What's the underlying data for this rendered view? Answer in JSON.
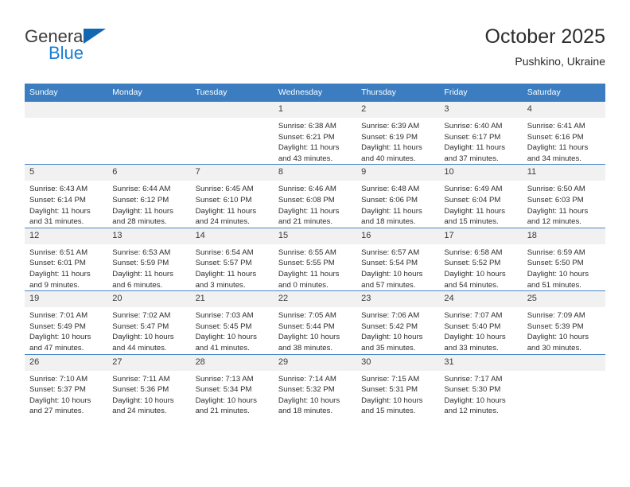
{
  "brand": {
    "line1": "General",
    "line2": "Blue",
    "logo_icon": "triangle-flag-icon"
  },
  "header": {
    "title": "October 2025",
    "subtitle": "Pushkino, Ukraine"
  },
  "calendar": {
    "weekday_headers": [
      "Sunday",
      "Monday",
      "Tuesday",
      "Wednesday",
      "Thursday",
      "Friday",
      "Saturday"
    ],
    "accent_color": "#3b7dc0",
    "daynum_bg": "#f1f1f1",
    "weeks": [
      [
        {
          "day": "",
          "info": "",
          "empty": true
        },
        {
          "day": "",
          "info": "",
          "empty": true
        },
        {
          "day": "",
          "info": "",
          "empty": true
        },
        {
          "day": "1",
          "info": "Sunrise: 6:38 AM\nSunset: 6:21 PM\nDaylight: 11 hours\nand 43 minutes."
        },
        {
          "day": "2",
          "info": "Sunrise: 6:39 AM\nSunset: 6:19 PM\nDaylight: 11 hours\nand 40 minutes."
        },
        {
          "day": "3",
          "info": "Sunrise: 6:40 AM\nSunset: 6:17 PM\nDaylight: 11 hours\nand 37 minutes."
        },
        {
          "day": "4",
          "info": "Sunrise: 6:41 AM\nSunset: 6:16 PM\nDaylight: 11 hours\nand 34 minutes."
        }
      ],
      [
        {
          "day": "5",
          "info": "Sunrise: 6:43 AM\nSunset: 6:14 PM\nDaylight: 11 hours\nand 31 minutes."
        },
        {
          "day": "6",
          "info": "Sunrise: 6:44 AM\nSunset: 6:12 PM\nDaylight: 11 hours\nand 28 minutes."
        },
        {
          "day": "7",
          "info": "Sunrise: 6:45 AM\nSunset: 6:10 PM\nDaylight: 11 hours\nand 24 minutes."
        },
        {
          "day": "8",
          "info": "Sunrise: 6:46 AM\nSunset: 6:08 PM\nDaylight: 11 hours\nand 21 minutes."
        },
        {
          "day": "9",
          "info": "Sunrise: 6:48 AM\nSunset: 6:06 PM\nDaylight: 11 hours\nand 18 minutes."
        },
        {
          "day": "10",
          "info": "Sunrise: 6:49 AM\nSunset: 6:04 PM\nDaylight: 11 hours\nand 15 minutes."
        },
        {
          "day": "11",
          "info": "Sunrise: 6:50 AM\nSunset: 6:03 PM\nDaylight: 11 hours\nand 12 minutes."
        }
      ],
      [
        {
          "day": "12",
          "info": "Sunrise: 6:51 AM\nSunset: 6:01 PM\nDaylight: 11 hours\nand 9 minutes."
        },
        {
          "day": "13",
          "info": "Sunrise: 6:53 AM\nSunset: 5:59 PM\nDaylight: 11 hours\nand 6 minutes."
        },
        {
          "day": "14",
          "info": "Sunrise: 6:54 AM\nSunset: 5:57 PM\nDaylight: 11 hours\nand 3 minutes."
        },
        {
          "day": "15",
          "info": "Sunrise: 6:55 AM\nSunset: 5:55 PM\nDaylight: 11 hours\nand 0 minutes."
        },
        {
          "day": "16",
          "info": "Sunrise: 6:57 AM\nSunset: 5:54 PM\nDaylight: 10 hours\nand 57 minutes."
        },
        {
          "day": "17",
          "info": "Sunrise: 6:58 AM\nSunset: 5:52 PM\nDaylight: 10 hours\nand 54 minutes."
        },
        {
          "day": "18",
          "info": "Sunrise: 6:59 AM\nSunset: 5:50 PM\nDaylight: 10 hours\nand 51 minutes."
        }
      ],
      [
        {
          "day": "19",
          "info": "Sunrise: 7:01 AM\nSunset: 5:49 PM\nDaylight: 10 hours\nand 47 minutes."
        },
        {
          "day": "20",
          "info": "Sunrise: 7:02 AM\nSunset: 5:47 PM\nDaylight: 10 hours\nand 44 minutes."
        },
        {
          "day": "21",
          "info": "Sunrise: 7:03 AM\nSunset: 5:45 PM\nDaylight: 10 hours\nand 41 minutes."
        },
        {
          "day": "22",
          "info": "Sunrise: 7:05 AM\nSunset: 5:44 PM\nDaylight: 10 hours\nand 38 minutes."
        },
        {
          "day": "23",
          "info": "Sunrise: 7:06 AM\nSunset: 5:42 PM\nDaylight: 10 hours\nand 35 minutes."
        },
        {
          "day": "24",
          "info": "Sunrise: 7:07 AM\nSunset: 5:40 PM\nDaylight: 10 hours\nand 33 minutes."
        },
        {
          "day": "25",
          "info": "Sunrise: 7:09 AM\nSunset: 5:39 PM\nDaylight: 10 hours\nand 30 minutes."
        }
      ],
      [
        {
          "day": "26",
          "info": "Sunrise: 7:10 AM\nSunset: 5:37 PM\nDaylight: 10 hours\nand 27 minutes."
        },
        {
          "day": "27",
          "info": "Sunrise: 7:11 AM\nSunset: 5:36 PM\nDaylight: 10 hours\nand 24 minutes."
        },
        {
          "day": "28",
          "info": "Sunrise: 7:13 AM\nSunset: 5:34 PM\nDaylight: 10 hours\nand 21 minutes."
        },
        {
          "day": "29",
          "info": "Sunrise: 7:14 AM\nSunset: 5:32 PM\nDaylight: 10 hours\nand 18 minutes."
        },
        {
          "day": "30",
          "info": "Sunrise: 7:15 AM\nSunset: 5:31 PM\nDaylight: 10 hours\nand 15 minutes."
        },
        {
          "day": "31",
          "info": "Sunrise: 7:17 AM\nSunset: 5:30 PM\nDaylight: 10 hours\nand 12 minutes."
        },
        {
          "day": "",
          "info": "",
          "empty": true
        }
      ]
    ]
  }
}
